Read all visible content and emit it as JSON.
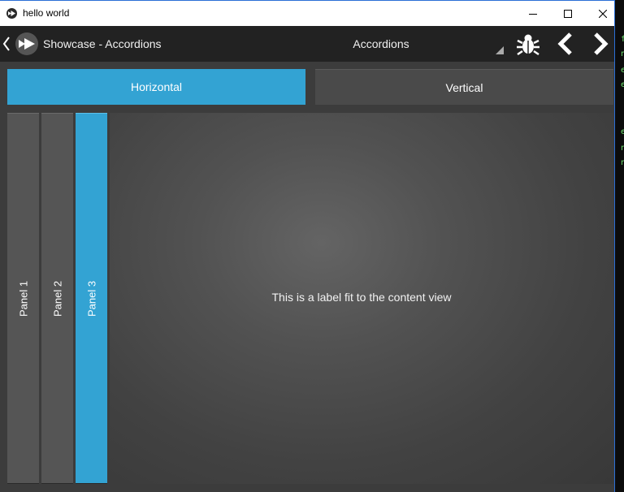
{
  "window": {
    "title": "hello world"
  },
  "actionbar": {
    "title": "Showcase - Accordions",
    "spinner_value": "Accordions"
  },
  "toggles": {
    "horizontal": "Horizontal",
    "vertical": "Vertical",
    "selected": "horizontal"
  },
  "accordion": {
    "panels": [
      {
        "label": "Panel 1",
        "selected": false
      },
      {
        "label": "Panel 2",
        "selected": false
      },
      {
        "label": "Panel 3",
        "selected": true
      }
    ],
    "content_text": "This is a label fit to the content view"
  },
  "colors": {
    "accent": "#33a3d3",
    "panel_bg": "#555555",
    "actionbar_bg": "#222222",
    "content_bg": "#3c3c3c"
  },
  "icons": {
    "app": "kivy-logo-icon",
    "back": "chevron-left-icon",
    "bug": "bug-icon",
    "prev": "chevron-left-icon",
    "next": "chevron-right-icon",
    "minimize": "minimize-icon",
    "maximize": "maximize-icon",
    "close": "close-icon"
  }
}
